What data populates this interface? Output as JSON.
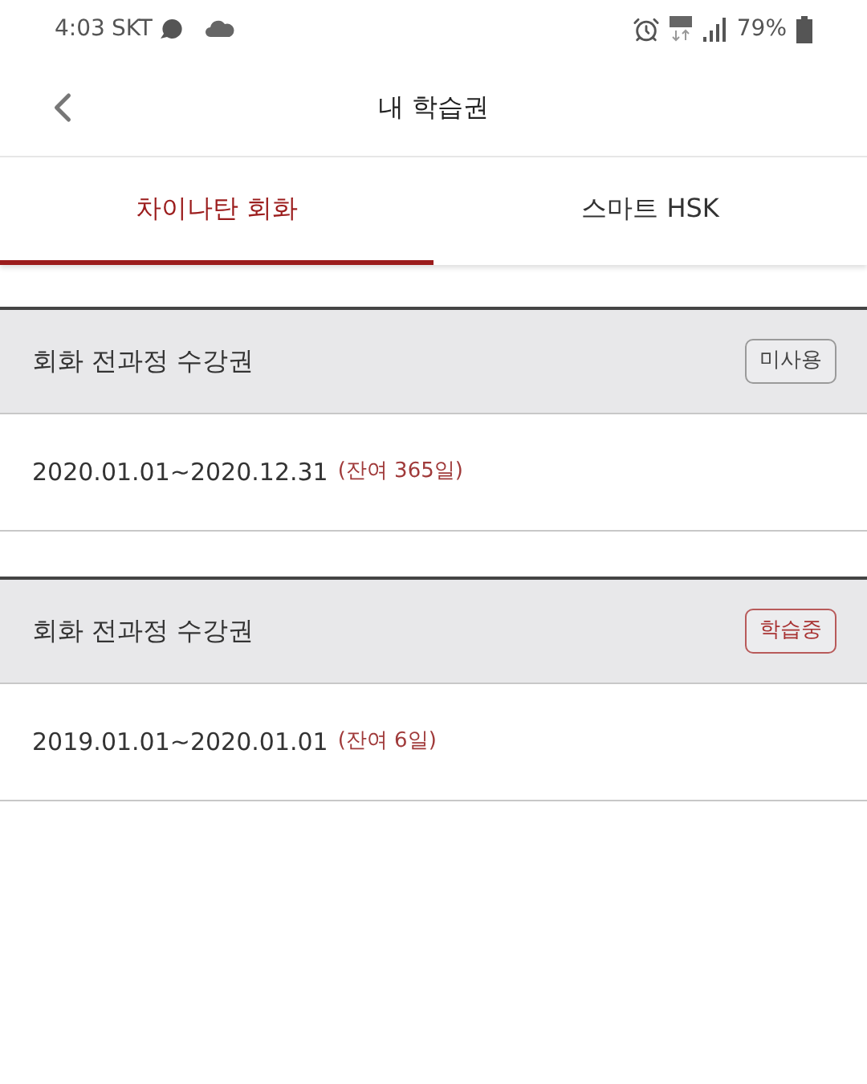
{
  "status_bar": {
    "time": "4:03",
    "carrier": "SKT",
    "battery": "79%"
  },
  "header": {
    "title": "내 학습권"
  },
  "tabs": [
    {
      "label": "차이나탄 회화",
      "selected": true
    },
    {
      "label": "스마트 HSK",
      "selected": false
    }
  ],
  "passes": [
    {
      "name": "회화 전과정 수강권",
      "badge": {
        "label": "미사용",
        "kind": "unused"
      },
      "period": "2020.01.01~2020.12.31",
      "remaining": "(잔여 365일)"
    },
    {
      "name": "회화 전과정 수강권",
      "badge": {
        "label": "학습중",
        "kind": "active"
      },
      "period": "2019.01.01~2020.01.01",
      "remaining": "(잔여 6일)"
    }
  ]
}
